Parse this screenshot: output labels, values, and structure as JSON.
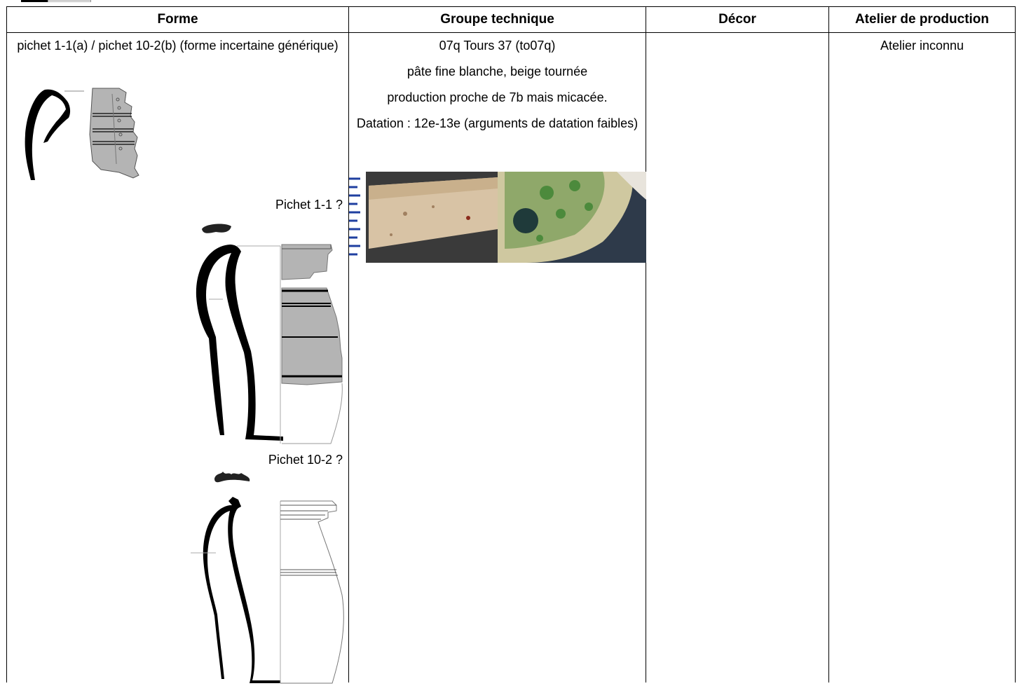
{
  "table": {
    "headers": {
      "forme": "Forme",
      "groupe": "Groupe technique",
      "decor": "Décor",
      "atelier": "Atelier de production"
    },
    "row": {
      "forme_description": "pichet 1-1(a) / pichet 10-2(b) (forme incertaine générique)",
      "forme_label_a": "Pichet 1-1 ?",
      "forme_label_b": "Pichet 10-2 ?",
      "groupe_lines": [
        "07q Tours 37 (to07q)",
        "pâte fine blanche, beige tournée",
        "production proche de 7b mais micacée.",
        "Datation : 12e-13e (arguments de datation faibles)"
      ],
      "decor": "",
      "atelier": "Atelier inconnu"
    }
  },
  "images": {
    "sherd_drawing": "rim-sherd-drawing",
    "jug_1_1": "pichet-1-1-profile-drawing",
    "jug_10_2": "pichet-10-2-profile-drawing",
    "fabric_photo": "fabric-photo-with-scale",
    "glaze_photo": "green-glaze-photo"
  },
  "colors": {
    "ink": "#000000",
    "grey_fill": "#b4b4b4",
    "sherd_beige": "#d8c3a5",
    "glaze_green": "#4c8a3c"
  }
}
